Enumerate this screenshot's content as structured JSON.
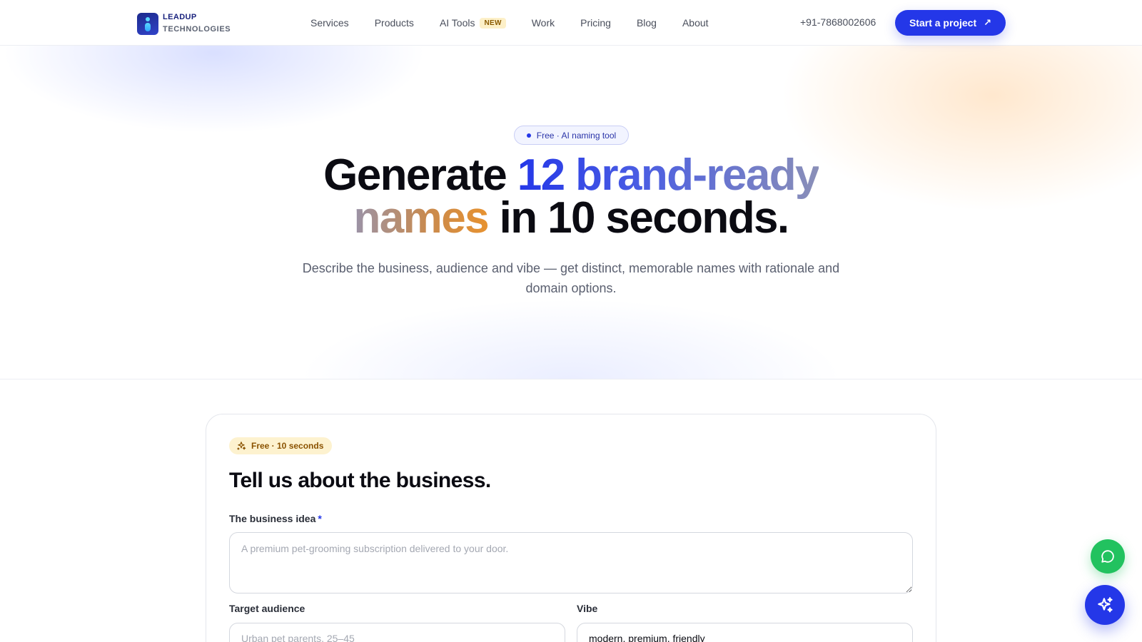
{
  "brand": {
    "line1": "LEADUP",
    "line2": "TECHNOLOGIES"
  },
  "nav": {
    "items": [
      {
        "label": "Services"
      },
      {
        "label": "Products"
      },
      {
        "label": "AI Tools",
        "badge": "NEW"
      },
      {
        "label": "Work"
      },
      {
        "label": "Pricing"
      },
      {
        "label": "Blog"
      },
      {
        "label": "About"
      }
    ],
    "phone": "+91-7868002606",
    "cta_label": "Start a project",
    "cta_icon": "arrow-up-right-icon"
  },
  "hero": {
    "pill": "Free · AI naming tool",
    "headline": {
      "part1": "Generate ",
      "accent1": "12 brand-ready",
      "accent2": "names",
      "part2": " in 10 seconds."
    },
    "subhead": "Describe the business, audience and vibe — get distinct, memorable names with rationale and domain options."
  },
  "form": {
    "chip": "Free · 10 seconds",
    "chip_icon": "sparkles-icon",
    "title": "Tell us about the business.",
    "idea": {
      "label": "The business idea",
      "required_mark": "*",
      "placeholder": "A premium pet-grooming subscription delivered to your door.",
      "value": ""
    },
    "audience": {
      "label": "Target audience",
      "placeholder": "Urban pet parents, 25–45",
      "value": ""
    },
    "vibe": {
      "label": "Vibe",
      "placeholder": "",
      "value": "modern, premium, friendly"
    }
  },
  "floating": {
    "chat_icon": "chat-bubble-icon",
    "ai_icon": "sparkles-icon"
  },
  "colors": {
    "accent": "#2437e8",
    "chat_green": "#22c25f",
    "warm_orange": "#e79230",
    "chip_bg": "#fdf2cf"
  }
}
